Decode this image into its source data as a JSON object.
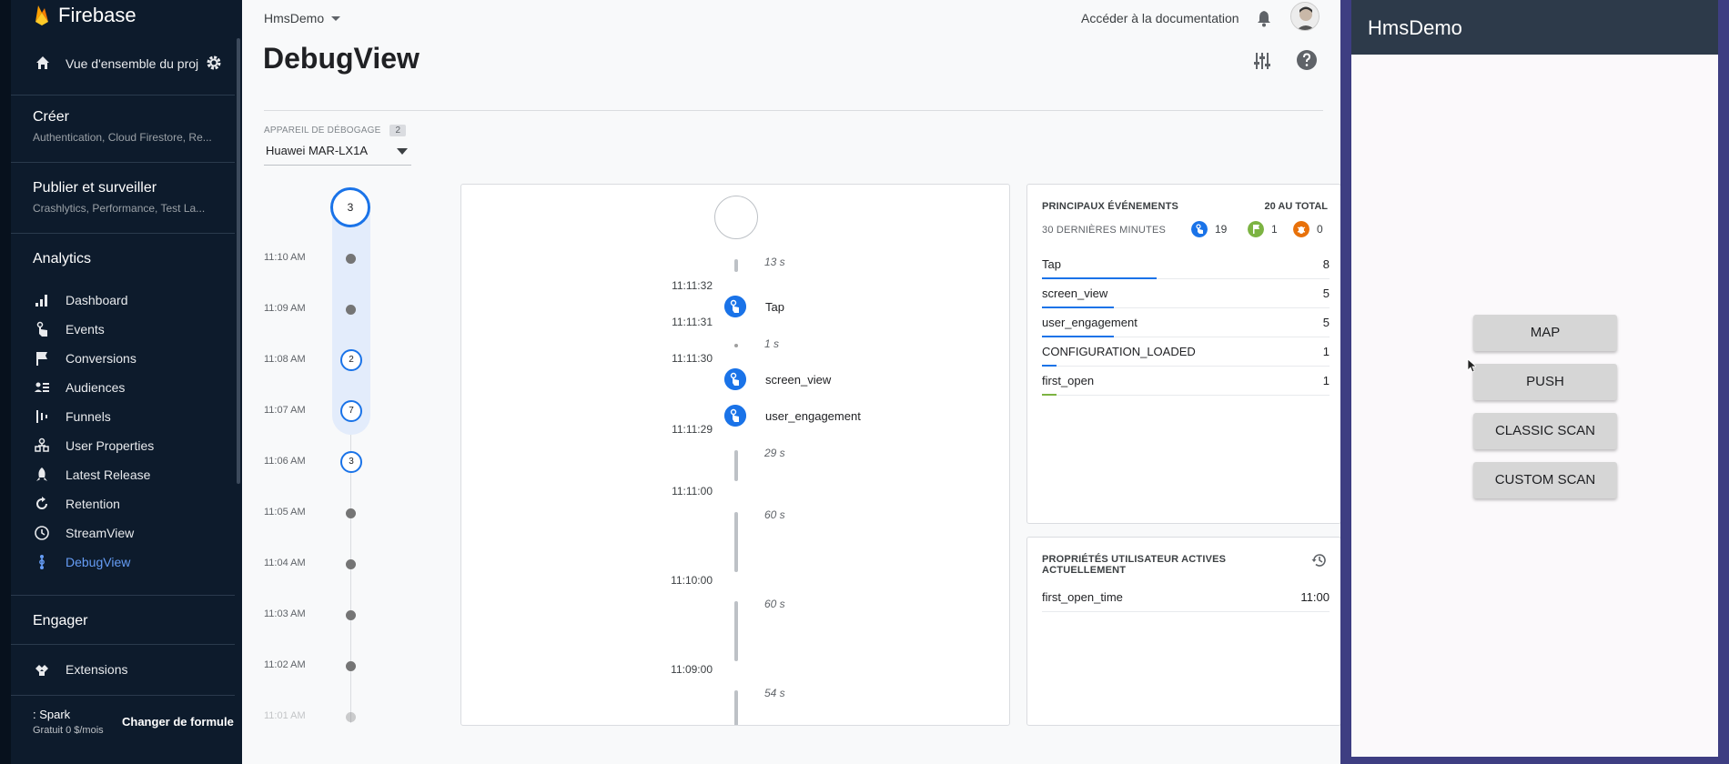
{
  "sidebar": {
    "brand": "Firebase",
    "overview_label": "Vue d'ensemble du proj",
    "sections": [
      {
        "title": "Créer",
        "sub": "Authentication, Cloud Firestore, Re..."
      },
      {
        "title": "Publier et surveiller",
        "sub": "Crashlytics, Performance, Test La..."
      }
    ],
    "analytics_title": "Analytics",
    "nav": [
      {
        "label": "Dashboard",
        "icon": "bar-chart-icon"
      },
      {
        "label": "Events",
        "icon": "touch-icon"
      },
      {
        "label": "Conversions",
        "icon": "flag-icon"
      },
      {
        "label": "Audiences",
        "icon": "audience-icon"
      },
      {
        "label": "Funnels",
        "icon": "funnel-icon"
      },
      {
        "label": "User Properties",
        "icon": "user-properties-icon"
      },
      {
        "label": "Latest Release",
        "icon": "release-icon"
      },
      {
        "label": "Retention",
        "icon": "retention-icon"
      },
      {
        "label": "StreamView",
        "icon": "clock-icon"
      },
      {
        "label": "DebugView",
        "icon": "debug-icon"
      }
    ],
    "active_nav": "DebugView",
    "engage_title": "Engager",
    "extensions_label": "Extensions",
    "plan_name": ": Spark",
    "plan_price": "Gratuit 0 $/mois",
    "change_plan": "Changer de formule"
  },
  "header": {
    "project": "HmsDemo",
    "doc_link": "Accéder à la documentation",
    "title": "DebugView"
  },
  "device": {
    "label": "APPAREIL DE DÉBOGAGE",
    "count": "2",
    "selected": "Huawei MAR-LX1A"
  },
  "minutes": {
    "top_count": "3",
    "rows": [
      {
        "time": "11:10 AM",
        "count": ""
      },
      {
        "time": "11:09 AM",
        "count": ""
      },
      {
        "time": "11:08 AM",
        "count": "2"
      },
      {
        "time": "11:07 AM",
        "count": "7"
      },
      {
        "time": "11:06 AM",
        "count": "3"
      },
      {
        "time": "11:05 AM",
        "count": ""
      },
      {
        "time": "11:04 AM",
        "count": ""
      },
      {
        "time": "11:03 AM",
        "count": ""
      },
      {
        "time": "11:02 AM",
        "count": ""
      },
      {
        "time": "11:01 AM",
        "count": ""
      }
    ]
  },
  "stream": {
    "times": [
      "11:11:32",
      "11:11:31",
      "11:11:30",
      "11:11:29",
      "11:11:00",
      "11:10:00",
      "11:09:00"
    ],
    "durations": [
      "13 s",
      "1 s",
      "29 s",
      "60 s",
      "60 s",
      "54 s"
    ],
    "events": [
      "Tap",
      "screen_view",
      "user_engagement"
    ]
  },
  "top_events": {
    "title": "PRINCIPAUX ÉVÉNEMENTS",
    "total": "20 AU TOTAL",
    "subtitle": "30 DERNIÈRES MINUTES",
    "stats": [
      {
        "icon": "touch-icon",
        "value": "19",
        "color": "#1a73e8"
      },
      {
        "icon": "flag-icon",
        "value": "1",
        "color": "#7cb342"
      },
      {
        "icon": "bug-icon",
        "value": "0",
        "color": "#e8710a"
      }
    ],
    "rows": [
      {
        "name": "Tap",
        "value": "8",
        "share": 0.4,
        "color": "#1a73e8"
      },
      {
        "name": "screen_view",
        "value": "5",
        "share": 0.25,
        "color": "#1a73e8"
      },
      {
        "name": "user_engagement",
        "value": "5",
        "share": 0.25,
        "color": "#1a73e8"
      },
      {
        "name": "CONFIGURATION_LOADED",
        "value": "1",
        "share": 0.05,
        "color": "#1a73e8"
      },
      {
        "name": "first_open",
        "value": "1",
        "share": 0.05,
        "color": "#7cb342"
      }
    ]
  },
  "user_props": {
    "title": "PROPRIÉTÉS UTILISATEUR ACTIVES ACTUELLEMENT",
    "rows": [
      {
        "name": "first_open_time",
        "value": "11:00"
      }
    ]
  },
  "phone": {
    "app_title": "HmsDemo",
    "buttons": [
      "MAP",
      "PUSH",
      "CLASSIC SCAN",
      "CUSTOM SCAN"
    ]
  }
}
